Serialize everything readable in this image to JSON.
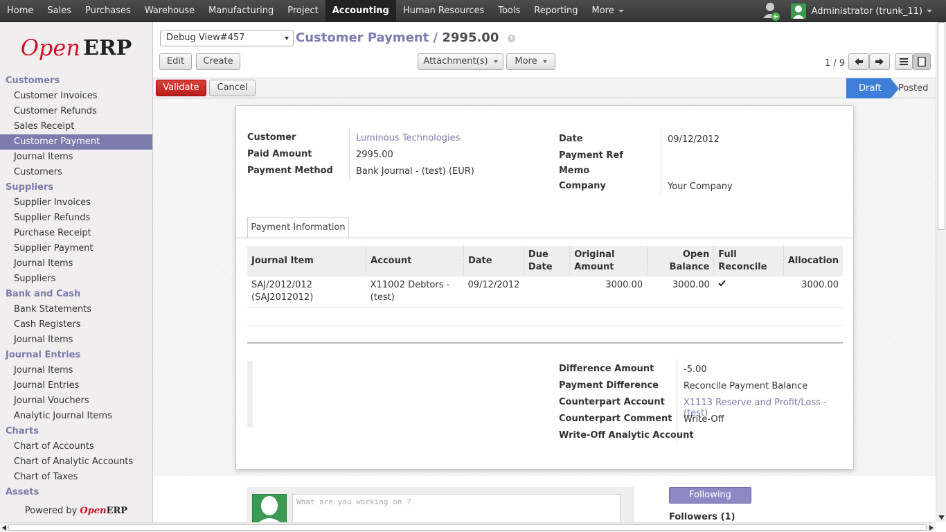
{
  "topbar": {
    "menus": [
      "Home",
      "Sales",
      "Purchases",
      "Warehouse",
      "Manufacturing",
      "Project",
      "Accounting",
      "Human Resources",
      "Tools",
      "Reporting",
      "More"
    ],
    "active_menu": "Accounting",
    "user": "Administrator (trunk_11)"
  },
  "sidebar": {
    "sections": [
      {
        "title": "Customers",
        "items": [
          "Customer Invoices",
          "Customer Refunds",
          "Sales Receipt",
          "Customer Payment",
          "Journal Items",
          "Customers"
        ]
      },
      {
        "title": "Suppliers",
        "items": [
          "Supplier Invoices",
          "Supplier Refunds",
          "Purchase Receipt",
          "Supplier Payment",
          "Journal Items",
          "Suppliers"
        ]
      },
      {
        "title": "Bank and Cash",
        "items": [
          "Bank Statements",
          "Cash Registers",
          "Journal Items"
        ]
      },
      {
        "title": "Journal Entries",
        "items": [
          "Journal Items",
          "Journal Entries",
          "Journal Vouchers",
          "Analytic Journal Items"
        ]
      },
      {
        "title": "Charts",
        "items": [
          "Chart of Accounts",
          "Chart of Analytic Accounts",
          "Chart of Taxes"
        ]
      },
      {
        "title": "Assets",
        "items": []
      }
    ],
    "active_item": "Customer Payment",
    "logo_open": "Open",
    "logo_erp": "ERP",
    "powered_by": "Powered by",
    "powered_open": "Open",
    "powered_erp": "ERP"
  },
  "header": {
    "debug_select": "Debug View#457",
    "breadcrumb_link": "Customer Payment",
    "breadcrumb_sep": "/",
    "breadcrumb_current": "2995.00",
    "help": "?",
    "edit_label": "Edit",
    "create_label": "Create",
    "attachments_label": "Attachment(s)",
    "more_label": "More",
    "pager": "1 / 9"
  },
  "statusbar": {
    "validate_label": "Validate",
    "cancel_label": "Cancel",
    "stages": [
      "Draft",
      "Posted"
    ],
    "current_stage": "Draft"
  },
  "form": {
    "customer_label": "Customer",
    "customer_value": "Luminous Technologies",
    "paid_amount_label": "Paid Amount",
    "paid_amount_value": "2995.00",
    "payment_method_label": "Payment Method",
    "payment_method_value": "Bank Journal - (test) (EUR)",
    "date_label": "Date",
    "date_value": "09/12/2012",
    "payment_ref_label": "Payment Ref",
    "memo_label": "Memo",
    "company_label": "Company",
    "company_value": "Your Company",
    "tab_label": "Payment Information"
  },
  "table": {
    "headers": [
      "Journal Item",
      "Account",
      "Date",
      "Due Date",
      "Original Amount",
      "Open Balance",
      "Full Reconcile",
      "Allocation"
    ],
    "row": {
      "journal_item": "SAJ/2012/012 (SAJ2012012)",
      "account": "X11002 Debtors - (test)",
      "date": "09/12/2012",
      "due_date": "",
      "original_amount": "3000.00",
      "open_balance": "3000.00",
      "full_reconcile": true,
      "allocation": "3000.00"
    }
  },
  "difference": {
    "difference_amount_label": "Difference Amount",
    "difference_amount_value": "-5.00",
    "payment_difference_label": "Payment Difference",
    "payment_difference_value": "Reconcile Payment Balance",
    "counterpart_account_label": "Counterpart Account",
    "counterpart_account_value": "X1113 Reserve and Profit/Loss - (test)",
    "counterpart_comment_label": "Counterpart Comment",
    "counterpart_comment_value": "Write-Off",
    "writeoff_analytic_label": "Write-Off Analytic Account"
  },
  "chatter": {
    "placeholder": "What are you working on ?",
    "following_label": "Following",
    "followers_label": "Followers (1)"
  }
}
